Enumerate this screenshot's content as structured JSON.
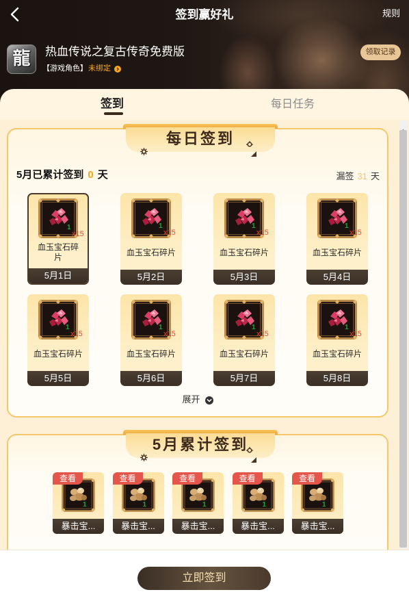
{
  "header": {
    "title": "签到赢好礼",
    "rules_label": "规则",
    "back_icon": "chevron-left-icon"
  },
  "game": {
    "logo_glyph": "龍",
    "name": "热血传说之复古传奇免费版",
    "role_label": "【游戏角色】",
    "bind_status": "未绑定",
    "bind_icon": "circle-chevron-right-icon",
    "records_button": "领取记录"
  },
  "tabs": [
    {
      "label": "签到",
      "active": true
    },
    {
      "label": "每日任务",
      "active": false
    }
  ],
  "ribbon_icons": [
    "gear-icon",
    "sparkle-ring-icon",
    "triangle-icon"
  ],
  "daily": {
    "title": "每日签到",
    "summary_label": "5月已累计签到",
    "summary_count": "0",
    "summary_unit": "天",
    "missed_label": "漏签",
    "missed_count": "31",
    "missed_unit": "天",
    "items": [
      {
        "name": "血玉宝石碎片",
        "quantity": "x15",
        "count": "1",
        "date": "5月1日",
        "icon": "red-gem-fragment-icon",
        "current": true
      },
      {
        "name": "血玉宝石碎片",
        "quantity": "x15",
        "count": "1",
        "date": "5月2日",
        "icon": "red-gem-fragment-icon",
        "current": false
      },
      {
        "name": "血玉宝石碎片",
        "quantity": "x15",
        "count": "1",
        "date": "5月3日",
        "icon": "red-gem-fragment-icon",
        "current": false
      },
      {
        "name": "血玉宝石碎片",
        "quantity": "x15",
        "count": "1",
        "date": "5月4日",
        "icon": "red-gem-fragment-icon",
        "current": false
      },
      {
        "name": "血玉宝石碎片",
        "quantity": "x15",
        "count": "1",
        "date": "5月5日",
        "icon": "red-gem-fragment-icon",
        "current": false
      },
      {
        "name": "血玉宝石碎片",
        "quantity": "x15",
        "count": "1",
        "date": "5月6日",
        "icon": "red-gem-fragment-icon",
        "current": false
      },
      {
        "name": "血玉宝石碎片",
        "quantity": "x15",
        "count": "1",
        "date": "5月7日",
        "icon": "red-gem-fragment-icon",
        "current": false
      },
      {
        "name": "血玉宝石碎片",
        "quantity": "x15",
        "count": "1",
        "date": "5月8日",
        "icon": "red-gem-fragment-icon",
        "current": false
      }
    ],
    "expand_label": "展开",
    "expand_icon": "circle-chevron-down-icon"
  },
  "cumulative": {
    "title": "5月累计签到",
    "items": [
      {
        "tag": "查看",
        "name": "暴击宝...",
        "count": "1",
        "icon": "gold-ore-icon"
      },
      {
        "tag": "查看",
        "name": "暴击宝...",
        "count": "1",
        "icon": "gold-ore-icon"
      },
      {
        "tag": "查看",
        "name": "暴击宝...",
        "count": "1",
        "icon": "gold-ore-icon"
      },
      {
        "tag": "查看",
        "name": "暴击宝...",
        "count": "1",
        "icon": "gold-ore-icon"
      },
      {
        "tag": "查看",
        "name": "暴击宝...",
        "count": "1",
        "icon": "gold-ore-icon"
      }
    ]
  },
  "footer": {
    "sign_button": "立即签到"
  },
  "colors": {
    "accent_orange": "#f5a623",
    "missed_orange": "#f7c07a",
    "card_border": "#f3c76a",
    "date_bar": "#3b2f26",
    "tag_red": "#e4554b",
    "quantity_red": "#e0453a",
    "count_green": "#22a43a",
    "button_dark": "#4a3a2c"
  }
}
